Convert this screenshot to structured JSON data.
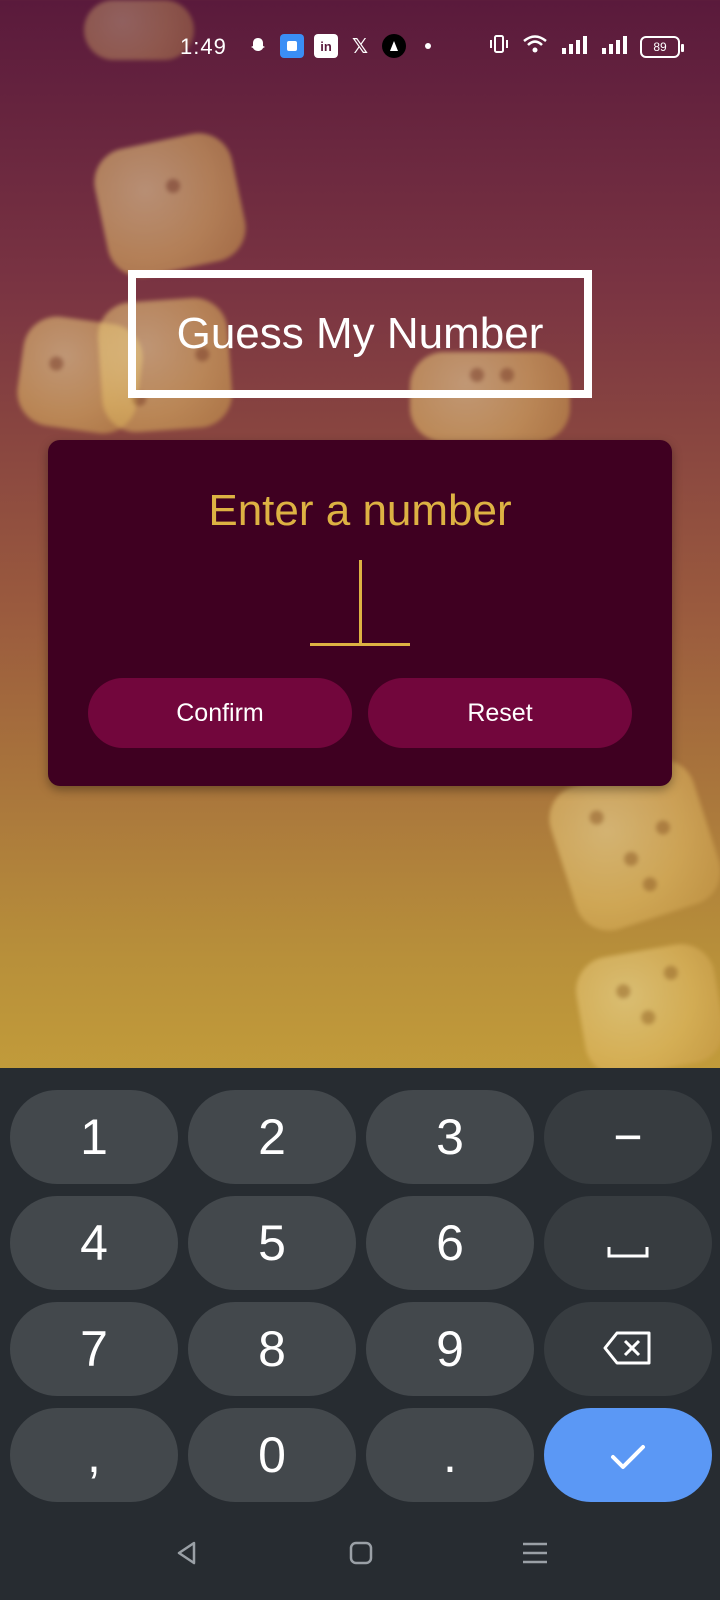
{
  "status_bar": {
    "time": "1:49",
    "battery": "89",
    "left_icons": [
      "snapchat-icon",
      "app-icon",
      "linkedin-icon",
      "x-icon",
      "threads-icon",
      "dot-icon"
    ],
    "right_icons": [
      "vibrate-icon",
      "wifi-icon",
      "signal-icon",
      "signal-icon",
      "battery-icon"
    ]
  },
  "app": {
    "title": "Guess My Number",
    "card": {
      "prompt": "Enter a number",
      "input_value": "",
      "confirm_label": "Confirm",
      "reset_label": "Reset"
    }
  },
  "colors": {
    "accent": "#ddb243",
    "card_bg": "#3f0021",
    "button_bg": "#72063c",
    "keyboard_bg": "#272c31",
    "done_key": "#5b98f5"
  },
  "keyboard": {
    "rows": [
      [
        "1",
        "2",
        "3",
        "−"
      ],
      [
        "4",
        "5",
        "6",
        "space"
      ],
      [
        "7",
        "8",
        "9",
        "backspace"
      ],
      [
        ",",
        "0",
        ".",
        "done"
      ]
    ],
    "labels": {
      "k1": "1",
      "k2": "2",
      "k3": "3",
      "minus": "−",
      "k4": "4",
      "k5": "5",
      "k6": "6",
      "k7": "7",
      "k8": "8",
      "k9": "9",
      "comma": ",",
      "k0": "0",
      "period": "."
    }
  },
  "nav_bar": [
    "back-icon",
    "home-icon",
    "recents-icon"
  ]
}
